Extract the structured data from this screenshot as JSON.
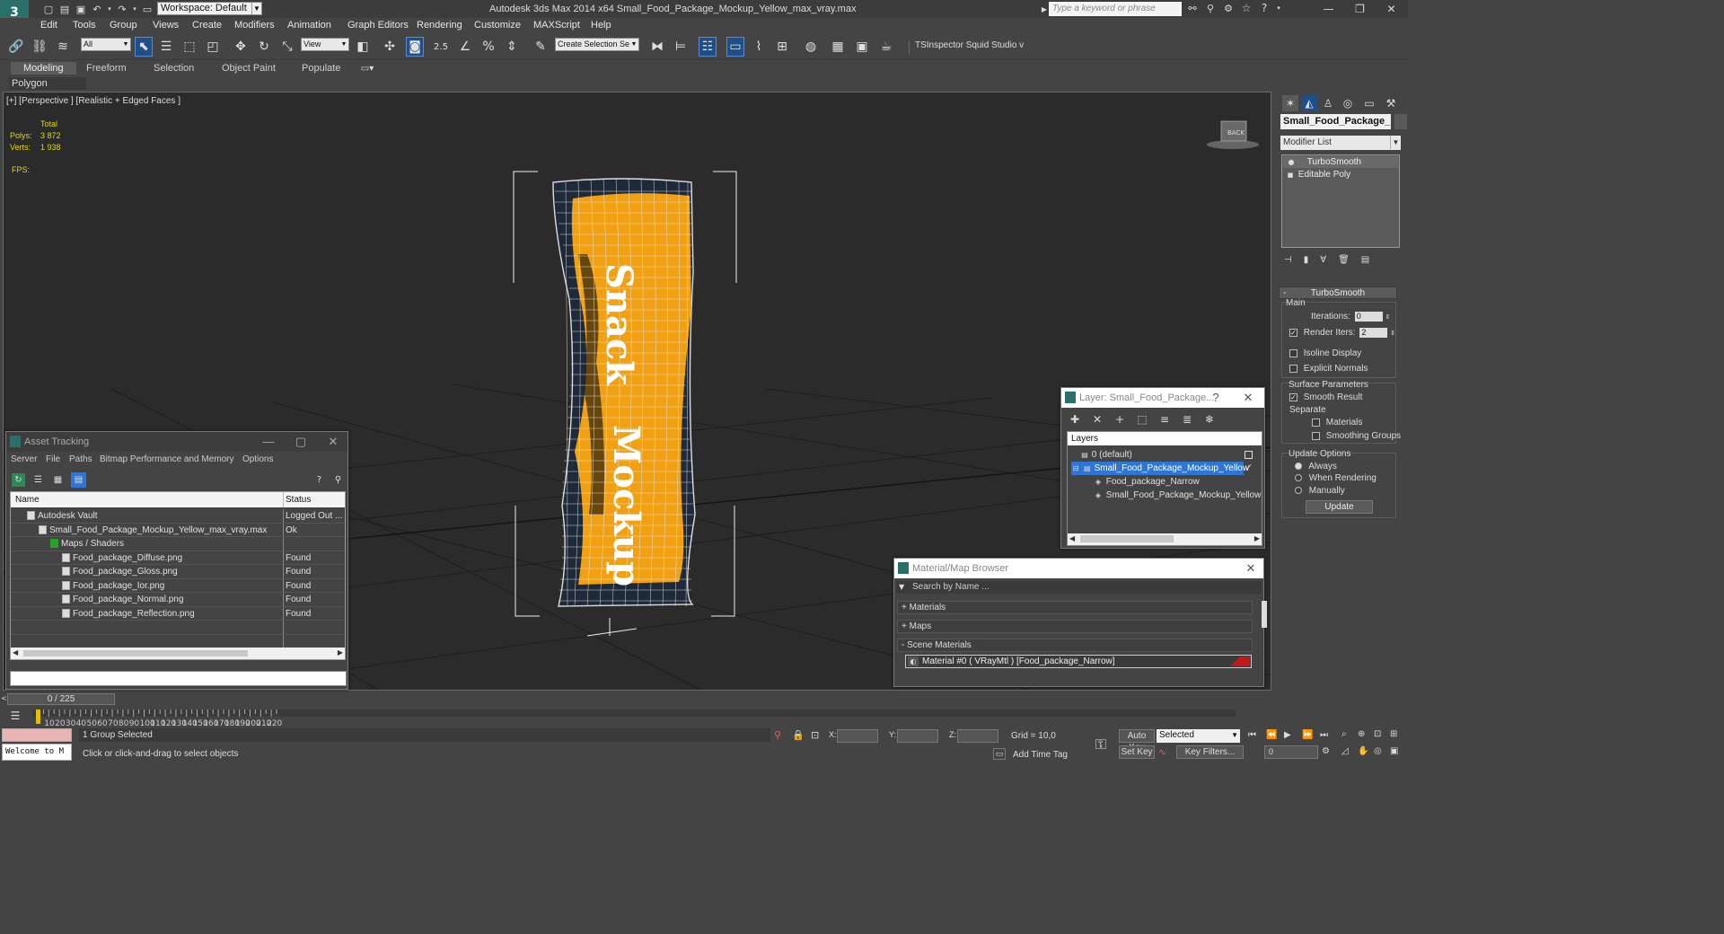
{
  "app": {
    "title": "Autodesk 3ds Max  2014 x64     Small_Food_Package_Mockup_Yellow_max_vray.max",
    "workspace": "Workspace: Default",
    "search_placeholder": "Type a keyword or phrase"
  },
  "menu": [
    "Edit",
    "Tools",
    "Group",
    "Views",
    "Create",
    "Modifiers",
    "Animation",
    "Graph Editors",
    "Rendering",
    "Customize",
    "MAXScript",
    "Help"
  ],
  "toolbar": {
    "filter_value": "All",
    "refcoord_value": "View",
    "snap_value": "2.5",
    "selection_set_placeholder": "Create Selection Se",
    "plugin_labels": "TSInspector  Squid Studio v"
  },
  "ribbon": {
    "tabs": [
      "Modeling",
      "Freeform",
      "Selection",
      "Object Paint",
      "Populate"
    ],
    "active_tab": "Modeling",
    "panel": "Polygon Modeling"
  },
  "viewport": {
    "label": "[+] [Perspective ] [Realistic + Edged Faces ]",
    "stats_header": "Total",
    "polys_label": "Polys:",
    "polys_value": "3 872",
    "verts_label": "Verts:",
    "verts_value": "1 938",
    "fps_label": "FPS:",
    "product_text_1": "Snack",
    "product_text_2": "Mockup",
    "viewcube_label": "BACK"
  },
  "command_panel": {
    "object_name": "Small_Food_Package_Mc",
    "modifier_list": "Modifier List",
    "stack": [
      "TurboSmooth",
      "Editable Poly"
    ],
    "rollout_title": "TurboSmooth",
    "main_label": "Main",
    "iterations_label": "Iterations:",
    "iterations_value": "0",
    "render_iters_label": "Render Iters:",
    "render_iters_value": "2",
    "render_iters_checked": true,
    "isoline_label": "Isoline Display",
    "explicit_normals_label": "Explicit Normals",
    "surface_params_label": "Surface Parameters",
    "smooth_result_label": "Smooth Result",
    "smooth_result_checked": true,
    "separate_label": "Separate",
    "materials_label": "Materials",
    "smoothing_groups_label": "Smoothing Groups",
    "update_options_label": "Update Options",
    "always_label": "Always",
    "when_rendering_label": "When Rendering",
    "manually_label": "Manually",
    "update_button": "Update",
    "selected_update_option": "Always"
  },
  "asset_tracking": {
    "title": "Asset Tracking",
    "menu": [
      "Server",
      "File",
      "Paths",
      "Bitmap Performance and Memory",
      "Options"
    ],
    "columns": [
      "Name",
      "Status"
    ],
    "rows": [
      {
        "name": "Autodesk Vault",
        "status": "Logged Out ...",
        "indent": 1
      },
      {
        "name": "Small_Food_Package_Mockup_Yellow_max_vray.max",
        "status": "Ok",
        "indent": 2
      },
      {
        "name": "Maps / Shaders",
        "status": "",
        "indent": 3
      },
      {
        "name": "Food_package_Diffuse.png",
        "status": "Found",
        "indent": 4
      },
      {
        "name": "Food_package_Gloss.png",
        "status": "Found",
        "indent": 4
      },
      {
        "name": "Food_package_Ior.png",
        "status": "Found",
        "indent": 4
      },
      {
        "name": "Food_package_Normal.png",
        "status": "Found",
        "indent": 4
      },
      {
        "name": "Food_package_Reflection.png",
        "status": "Found",
        "indent": 4
      },
      {
        "name": "",
        "status": "",
        "indent": 0
      },
      {
        "name": "",
        "status": "",
        "indent": 0
      }
    ]
  },
  "layer_window": {
    "title": "Layer: Small_Food_Package...",
    "help": "?",
    "header": "Layers",
    "rows": [
      {
        "name": "0 (default)",
        "indent": 0,
        "selected": false
      },
      {
        "name": "Small_Food_Package_Mockup_Yellow",
        "indent": 0,
        "selected": true
      },
      {
        "name": "Food_package_Narrow",
        "indent": 1,
        "selected": false
      },
      {
        "name": "Small_Food_Package_Mockup_Yellow",
        "indent": 1,
        "selected": false
      }
    ]
  },
  "material_browser": {
    "title": "Material/Map Browser",
    "search_placeholder": "Search by Name ...",
    "groups": [
      "+ Materials",
      "+ Maps",
      "- Scene Materials"
    ],
    "material_entry": "Material #0  ( VRayMtl )  [Food_package_Narrow]"
  },
  "timeline": {
    "frame_display": "0 / 225",
    "ticks": [
      "10",
      "20",
      "30",
      "40",
      "50",
      "60",
      "70",
      "80",
      "90",
      "100",
      "110",
      "120",
      "130",
      "140",
      "150",
      "160",
      "170",
      "180",
      "190",
      "200",
      "210",
      "220"
    ]
  },
  "status": {
    "maxscript": "Welcome to M",
    "selection_info": "1 Group Selected",
    "prompt": "Click or click-and-drag to select objects",
    "x_label": "X:",
    "y_label": "Y:",
    "z_label": "Z:",
    "grid": "Grid = 10,0",
    "add_time_tag": "Add Time Tag",
    "auto_key": "Auto Key",
    "set_key": "Set Key",
    "selected_dropdown": "Selected",
    "key_filters": "Key Filters...",
    "frame_value": "0"
  }
}
